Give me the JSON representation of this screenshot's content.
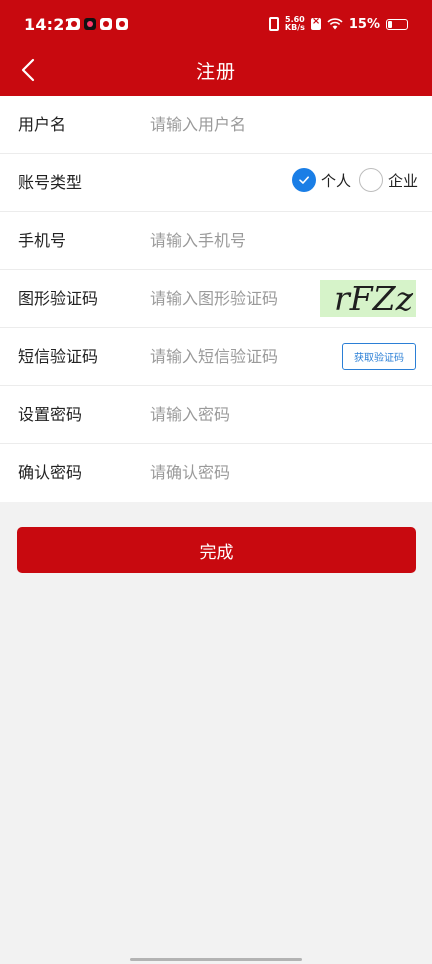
{
  "status_bar": {
    "time": "14:22",
    "net_speed_value": "5.60",
    "net_speed_unit": "KB/s",
    "battery_percent": "15%",
    "app_icons": [
      "app-icon",
      "tiktok-icon",
      "app-icon",
      "app-icon"
    ]
  },
  "header": {
    "title": "注册"
  },
  "form": {
    "username": {
      "label": "用户名",
      "placeholder": "请输入用户名",
      "value": ""
    },
    "account_type": {
      "label": "账号类型",
      "options": [
        {
          "label": "个人",
          "selected": true
        },
        {
          "label": "企业",
          "selected": false
        }
      ]
    },
    "phone": {
      "label": "手机号",
      "placeholder": "请输入手机号",
      "value": ""
    },
    "captcha": {
      "label": "图形验证码",
      "placeholder": "请输入图形验证码",
      "value": "",
      "image_text": "rFZz"
    },
    "sms_code": {
      "label": "短信验证码",
      "placeholder": "请输入短信验证码",
      "value": "",
      "button_label": "获取验证码"
    },
    "password": {
      "label": "设置密码",
      "placeholder": "请输入密码",
      "value": ""
    },
    "confirm_password": {
      "label": "确认密码",
      "placeholder": "请确认密码",
      "value": ""
    }
  },
  "submit_label": "完成",
  "colors": {
    "brand_red": "#c8090f",
    "radio_blue": "#1a7ee6",
    "link_blue": "#2b7fd6",
    "captcha_bg": "#d6f3c9"
  }
}
